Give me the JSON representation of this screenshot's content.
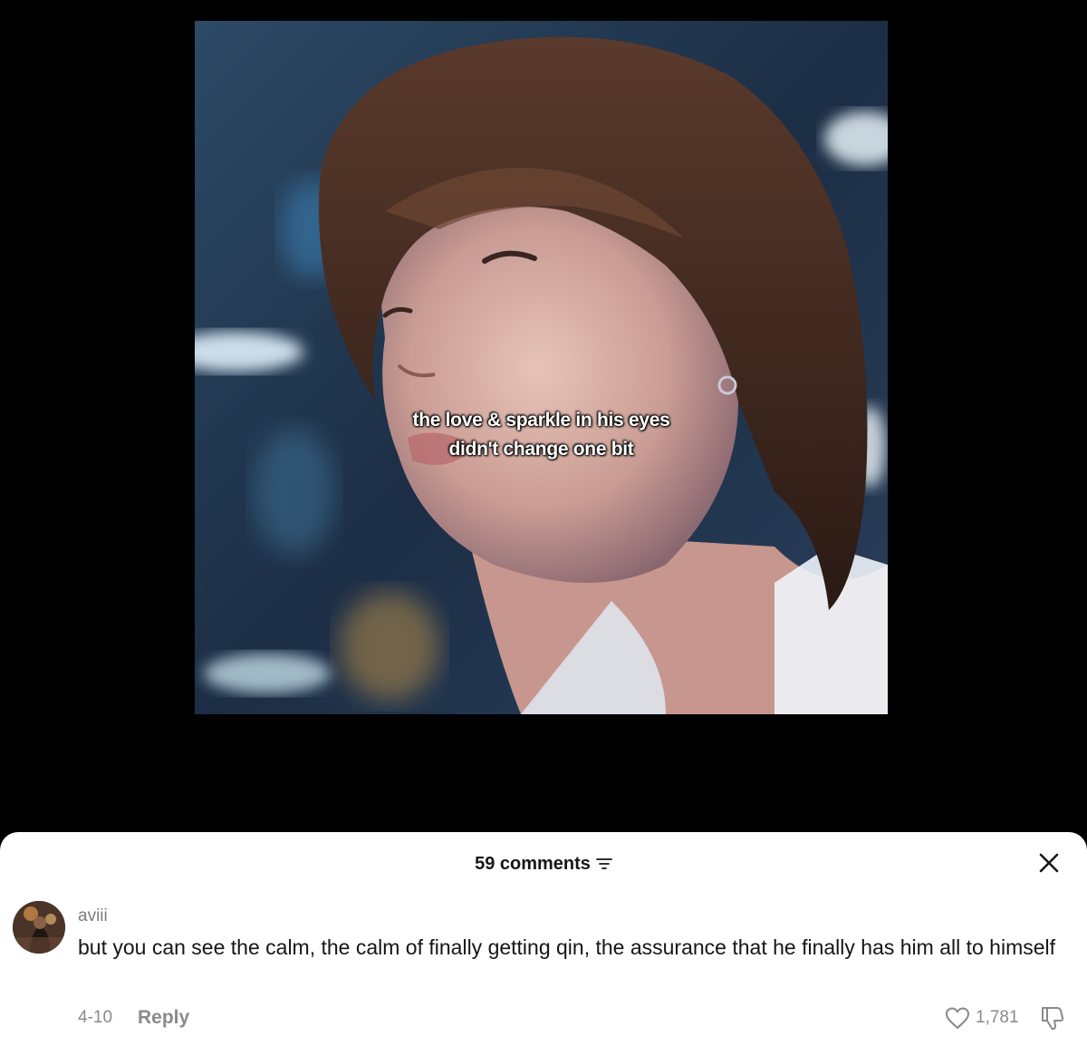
{
  "video": {
    "caption_line1": "the love & sparkle in his eyes",
    "caption_line2": "didn't change one bit"
  },
  "comments_panel": {
    "count_label": "59 comments",
    "filter_icon": "filter-icon",
    "close_icon": "close-icon"
  },
  "comment": {
    "username": "aviii",
    "text": "but you can see the calm, the calm of finally getting qin, the assurance that he finally has him all to himself",
    "date": "4-10",
    "reply_label": "Reply",
    "like_count": "1,781",
    "like_icon": "heart-icon",
    "dislike_icon": "thumbs-down-icon"
  },
  "colors": {
    "background": "#000000",
    "sheet": "#ffffff",
    "text_primary": "#161616",
    "text_muted": "#8a8a8a"
  }
}
